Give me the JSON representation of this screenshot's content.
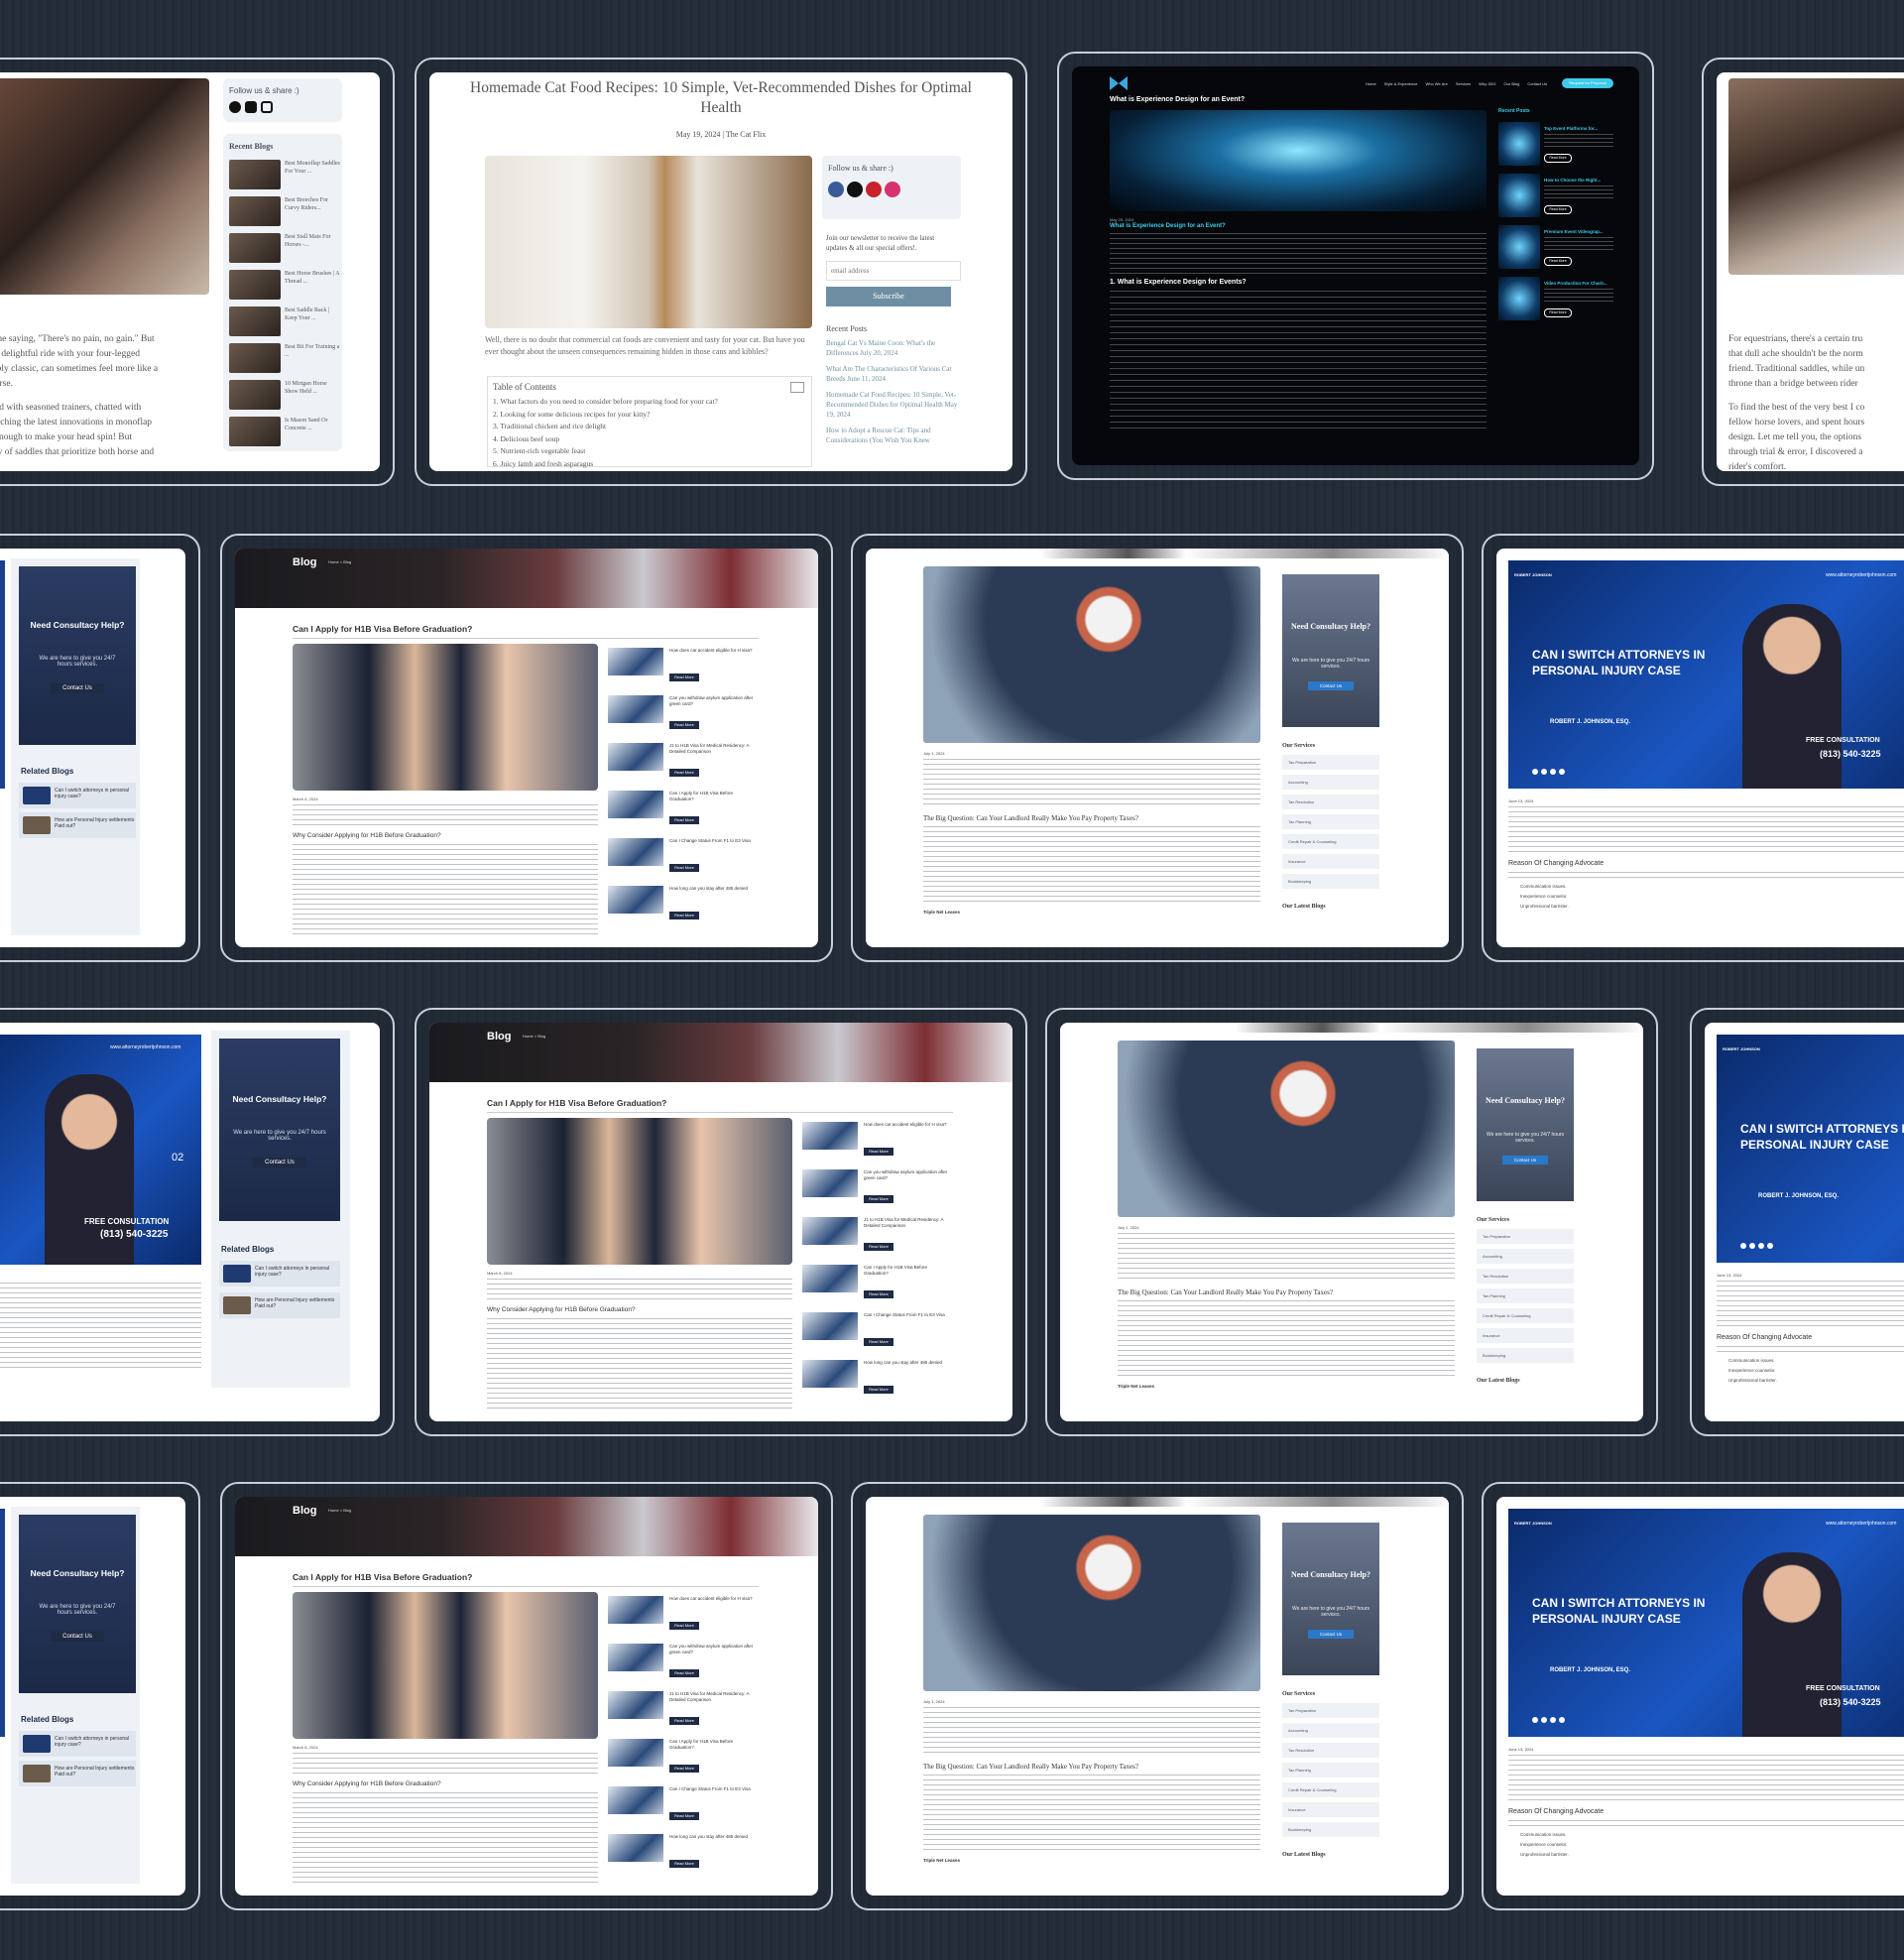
{
  "horse": {
    "follow": "Follow us & share :)",
    "recent_title": "Recent Blogs",
    "recent": [
      "Best Monoflap Saddles For Your ...",
      "Best Breeches For Curvy Riders...",
      "Best Stall Mats For Horses -...",
      "Best Horse Brushes | A Thread ...",
      "Best Saddle Rack | Keep Your ...",
      "Best Bit For Training a ...",
      "10 Mirtgan Horse Show Held ...",
      "Is Mason Sand Or Concrete ..."
    ],
    "body": [
      "to the saying, \"There's no pain, no gain.\" But",
      "er a delightful ride with your four-legged",
      "niably classic, can sometimes feel more like a",
      "l horse.",
      "ulted with seasoned trainers, chatted with",
      "searching the latest innovations in monoflap",
      "re enough to make your head spin! But",
      "riety of saddles that prioritize both horse and"
    ]
  },
  "cat": {
    "title": "Homemade Cat Food Recipes: 10 Simple, Vet-Recommended Dishes for Optimal Health",
    "meta": "May 19, 2024 | The Cat Flix",
    "follow": "Follow us & share :)",
    "newsletter": "Join our newsletter to receive the latest updates & all our special offers!.",
    "email_placeholder": "email address",
    "subscribe": "Subscribe",
    "recent_title": "Recent Posts",
    "recent": [
      "Bengal Cat Vs Maine Coon: What's the Differences July 20, 2024",
      "What Are The Characteristics Of Various Cat Breeds June 11, 2024",
      "Homemade Cat Food Recipes: 10 Simple, Vet-Recommended Dishes for Optimal Health May 19, 2024",
      "How to Adopt a Rescue Cat: Tips and Considerations (You Wish You Knew"
    ],
    "intro": "Well, there is no doubt that commercial cat foods are convenient and tasty for your cat. But have you ever thought about the unseen consequences remaining hidden in those cans and kibbles?",
    "toc_title": "Table of Contents",
    "toc": [
      "1. What factors do you need to consider before preparing food for your cat?",
      "2. Looking for some delicious recipes for your kitty?",
      "3. Traditional chicken and rice delight",
      "4. Delicious beef soup",
      "5. Nutrient-rich vegetable feast",
      "6. Juicy lamb and fresh asparagus"
    ]
  },
  "event": {
    "nav": [
      "Home",
      "Style & Experience",
      "Who We Are",
      "Services",
      "Why 2DG",
      "Our Blog",
      "Contact Us"
    ],
    "cta": "Request for Proposal",
    "title": "What is Experience Design for an Event?",
    "date": "May 25, 2024",
    "subtitle": "What is Experience Design for an Event?",
    "section": "1. What is Experience Design for Events?",
    "recent_title": "Recent Posts",
    "recent": [
      "Top Event Platforms for...",
      "How to Choose the Right...",
      "Premium Event Videograp...",
      "Video Production For Charit..."
    ],
    "read_more": "Read More"
  },
  "horse2": {
    "body": [
      "For equestrians, there's a certain tru",
      "that dull ache shouldn't be the norm",
      "friend. Traditional saddles, while un",
      "throne than a bridge between rider",
      "To find the best of the very best I co",
      "fellow horse lovers, and spent hours",
      "design.  Let me tell you, the options",
      "through trial & error, I discovered a",
      "rider's comfort."
    ]
  },
  "visa": {
    "blog": "Blog",
    "crumb": "Home  >  Blog",
    "title": "Can I Apply for H1B Visa Before Graduation?",
    "date": "March 8, 2024",
    "h2": "Why Consider Applying for H1B Before Graduation?",
    "read_more": "Read More",
    "side": [
      "How does car accident eligible for H visa?",
      "Can you withdraw asylum application after green card?",
      "J1 to H1B Visa for Medical Residency: A Detailed Comparison",
      "Can I Apply for H1B Visa Before Graduation?",
      "Can I Change Status From F1 to E3 Visa",
      "How long can you stay after 485 denied"
    ]
  },
  "tax": {
    "consult_title": "Need Consultacy Help?",
    "consult_sub": "We are here to give you 24/7 hours services.",
    "contact": "Contact Us",
    "date": "July 1, 2024",
    "heading": "The Big Question: Can Your Landlord Really Make You Pay Property Taxes?",
    "services_title": "Our Services",
    "services": [
      "Tax Preparation",
      "Accounting",
      "Tax Resolution",
      "Tax Planning",
      "Credit Repair & Counseling",
      "Insurance",
      "Bookkeeping"
    ],
    "latest": "Our Latest Blogs",
    "triple": "Triple Net Leases"
  },
  "lawyer": {
    "firm": "ROBERT JOHNSON",
    "url": "www.attorneyrobertjohnson.com",
    "headline_1": "CAN I SWITCH ATTORNEYS IN",
    "headline_2": "PERSONAL INJURY CASE",
    "signature": "ROBERT J. JOHNSON, ESQ.",
    "free": "FREE CONSULTATION",
    "phone": "(813) 540-3225",
    "date": "June 13, 2024",
    "section": "Reason Of Changing Advocate",
    "bullets": [
      "Communication issues.",
      "Inexperience counselor.",
      "Unprofessional barrister."
    ],
    "slide": "02"
  },
  "sidebar": {
    "consult_title": "Need Consultacy Help?",
    "consult_sub": "We are here to give you 24/7 hours services.",
    "contact": "Contact Us",
    "related": "Related Blogs",
    "items": [
      "Can I switch attorneys in personal injury case?",
      "How are Personal Injury settlements Paid out?"
    ]
  }
}
